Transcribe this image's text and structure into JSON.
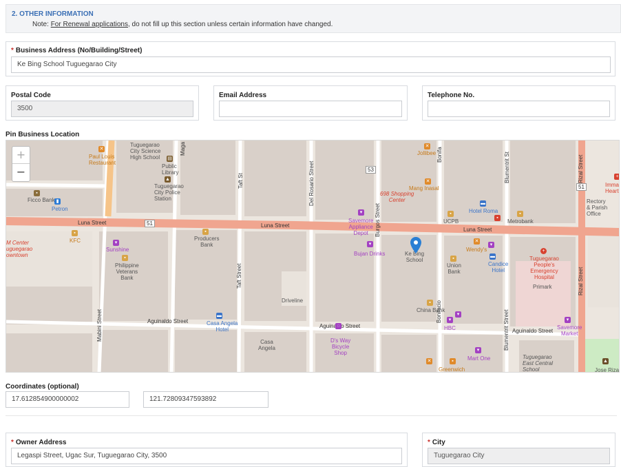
{
  "section": {
    "title": "2. OTHER INFORMATION",
    "note_prefix": "Note: ",
    "note_link": "For Renewal applications",
    "note_suffix": ", do not fill up this section unless certain information have changed."
  },
  "business_address": {
    "label": "Business Address (No/Building/Street)",
    "required_mark": "*",
    "value": "Ke Bing School Tuguegarao City"
  },
  "postal_code": {
    "label": "Postal Code",
    "value": "3500"
  },
  "email": {
    "label": "Email Address",
    "value": ""
  },
  "telephone": {
    "label": "Telephone No.",
    "value": ""
  },
  "map": {
    "label": "Pin Business Location",
    "zoom_in": "+",
    "zoom_out": "−",
    "labels": {
      "luna1": "Luna Street",
      "luna2": "Luna Street",
      "luna3": "Luna Street",
      "route51a": "51",
      "route51b": "51",
      "route53": "53",
      "aguinaldo1": "Aguinaldo Street",
      "aguinaldo2": "Aguinaldo Street",
      "aguinaldo3": "Aguinaldo Street",
      "mabini": "Mabini Street",
      "taft1": "Taft St",
      "taft2": "Taft Street",
      "delrosario": "Del Rosario Street",
      "burgos": "Burgos Street",
      "bonifacio1": "Bonifa",
      "bonifacio2": "Bonifacio",
      "blumentrit1": "Blumentrit St",
      "blumentrit2": "Blumentrit Street",
      "rizal1": "Rizal Street",
      "rizal2": "Rizal Street",
      "maga": "Maga",
      "paul_louis": "Paul Louis\nRestaurant",
      "science_hs": "Tuguegarao\nCity Science\nHigh School",
      "public_library": "Public\nLibrary",
      "police": "Tuguegarao\nCity Police\nStation",
      "ficco": "Ficco Bank",
      "petron": "Petron",
      "kfc": "KFC",
      "m_center": "M Center\nuguegarao\nowntown",
      "sunshine": "Sunshine",
      "ph_veterans": "Philippine\nVeterans\nBank",
      "producers": "Producers\nBank",
      "savemore_app": "Savemore\nAppliance\nDepot",
      "bujan": "Bujan Drinks",
      "ke_bing": "Ke Bing\nSchool",
      "jollibee": "Jollibee",
      "mang_inasal": "Mang Inasal",
      "shopping_698": "698 Shopping\nCenter",
      "ucpb": "UCPB",
      "hotel_roma": "Hotel Roma",
      "metrobank": "Metrobank",
      "wendys": "Wendy's",
      "union_bank": "Union\nBank",
      "candice": "Candice\nHotel",
      "people_hosp": "Tuguegarao\nPeople's\nEmergency\nHospital",
      "primark": "Primark",
      "rectory": "Rectory\n& Parish\nOffice",
      "immaculate": "Immac\nHeart",
      "driveline": "Driveline",
      "casa_angela_hotel": "Casa Angela\nHotel",
      "casa_angela": "Casa\nAngela",
      "ds_way": "D's Way\nBicycle\nShop",
      "china_bank": "China Bank",
      "hbc": "HBC",
      "mart_one": "Mart One",
      "greenwich": "Greenwich",
      "savemore_market": "Savemore\nMarket",
      "east_central": "Tuguegarao\nEast Central\nSchool",
      "jose_rizal": "Jose Rizal"
    }
  },
  "coordinates": {
    "label": "Coordinates (optional)",
    "latitude": "17.612854900000002",
    "longitude": "121.72809347593892"
  },
  "owner_address": {
    "label": "Owner Address",
    "required_mark": "*",
    "value": "Legaspi Street, Ugac Sur, Tuguegarao City, 3500"
  },
  "city": {
    "label": "City",
    "required_mark": "*",
    "value": "Tuguegarao City"
  },
  "colors": {
    "accent": "#3a6fb5",
    "required": "#c9302c",
    "road_major": "#f0a58f",
    "road_minor": "#ffffff",
    "building": "#d9d0c9",
    "map_bg": "#ece6df",
    "pin": "#2a7fd4"
  }
}
